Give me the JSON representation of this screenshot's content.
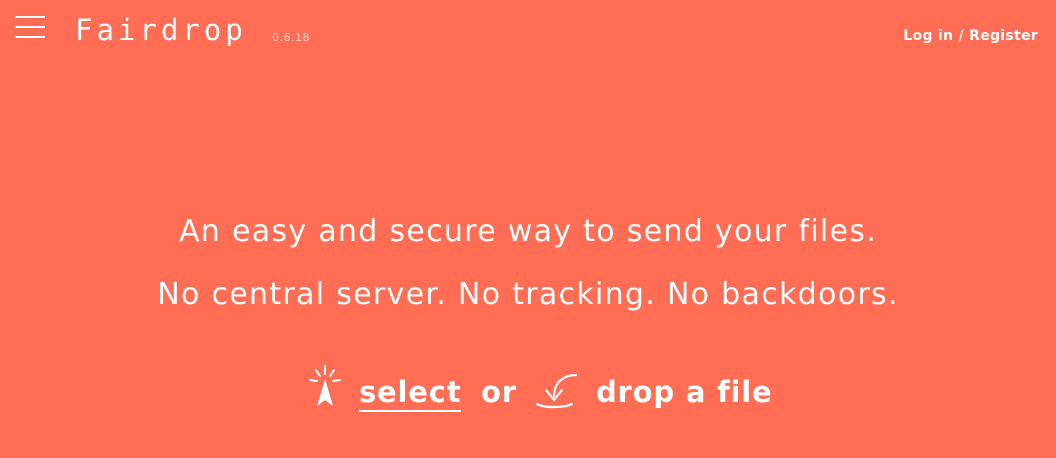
{
  "header": {
    "logo": "Fairdrop",
    "version": "0.6.18",
    "login_label": "Log in",
    "separator": " / ",
    "register_label": "Register"
  },
  "hero": {
    "line1": "An easy and secure way to send your files.",
    "line2": "No central server. No tracking. No backdoors."
  },
  "actions": {
    "select_label": "select",
    "or_label": "or",
    "drop_label": "drop a file"
  },
  "icons": {
    "menu": "hamburger-menu-icon",
    "select": "cursor-click-icon",
    "drop": "drop-arrow-icon"
  },
  "colors": {
    "background": "#ff6d54",
    "foreground": "#ffffff"
  }
}
